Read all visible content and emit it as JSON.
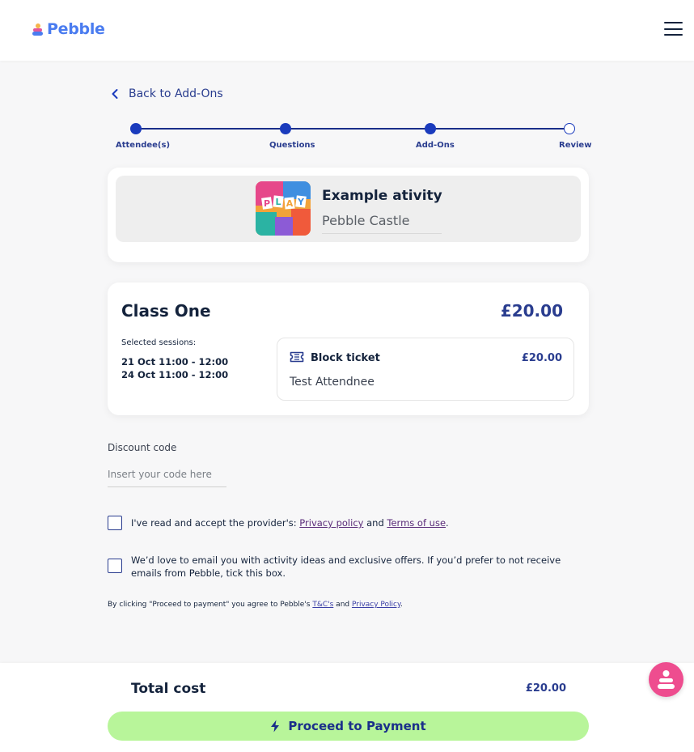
{
  "header": {
    "brand": "Pebble",
    "menu_icon": "hamburger-menu-icon"
  },
  "nav": {
    "back_label": "Back to Add-Ons"
  },
  "stepper": {
    "steps": [
      {
        "label": "Attendee(s)",
        "state": "complete"
      },
      {
        "label": "Questions",
        "state": "complete"
      },
      {
        "label": "Add-Ons",
        "state": "complete"
      },
      {
        "label": "Review",
        "state": "current"
      }
    ]
  },
  "activity": {
    "title": "Example ativity",
    "venue": "Pebble Castle",
    "thumbnail_text": "PLAY"
  },
  "booking": {
    "class_name": "Class One",
    "class_price": "£20.00",
    "sessions_label": "Selected sessions:",
    "sessions": [
      "21 Oct 11:00 - 12:00",
      "24 Oct 11:00 - 12:00"
    ],
    "ticket": {
      "name": "Block ticket",
      "price": "£20.00",
      "attendee": "Test Attendnee"
    }
  },
  "discount": {
    "label": "Discount code",
    "placeholder": "Insert your code here",
    "value": ""
  },
  "consents": {
    "terms_prefix": "I've read and accept the provider's: ",
    "privacy_link": "Privacy policy",
    "and": " and ",
    "terms_link": "Terms of use",
    "terms_suffix": ".",
    "marketing_text": "We’d love to email you with activity ideas and exclusive offers. If you’d prefer to not receive emails from Pebble, tick this box."
  },
  "legal": {
    "prefix": "By clicking \"Proceed to payment\" you agree to Pebble's ",
    "tc_link": "T&C's",
    "and": " and ",
    "privacy_link": "Privacy Policy",
    "suffix": "."
  },
  "footer": {
    "total_label": "Total cost",
    "total_value": "£20.00",
    "proceed_label": "Proceed to Payment"
  },
  "colors": {
    "brand_blue": "#4a7cf0",
    "navy": "#14233c",
    "accent_green": "#b8f59a",
    "chat_pink": "#ee4d8f"
  }
}
